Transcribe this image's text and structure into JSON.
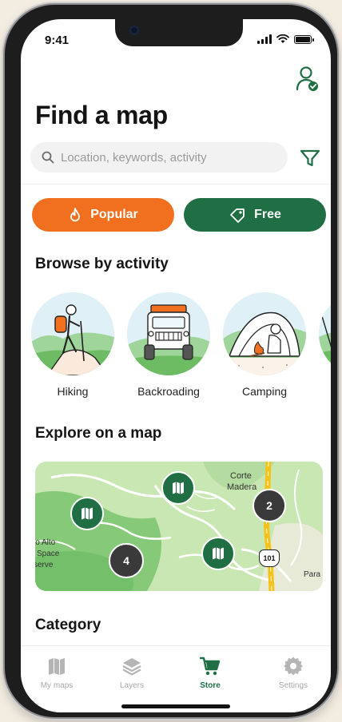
{
  "status": {
    "time": "9:41"
  },
  "header": {
    "title": "Find a map",
    "account_icon": "account-check-icon"
  },
  "search": {
    "placeholder": "Location, keywords, activity",
    "value": "",
    "filter_icon": "filter-funnel-icon"
  },
  "pills": [
    {
      "label": "Popular",
      "icon": "flame-icon",
      "color": "#f07020"
    },
    {
      "label": "Free",
      "icon": "tag-icon",
      "color": "#1f6e44"
    }
  ],
  "sections": {
    "activities_title": "Browse by activity",
    "map_title": "Explore on a map",
    "category_title": "Category"
  },
  "activities": [
    {
      "label": "Hiking",
      "icon": "hiking-illustration"
    },
    {
      "label": "Backroading",
      "icon": "backroading-illustration"
    },
    {
      "label": "Camping",
      "icon": "camping-illustration"
    },
    {
      "label": "",
      "icon": "more-activity-illustration"
    }
  ],
  "map": {
    "place_labels": [
      "Corte",
      "Madera",
      "lo Alto",
      "Space",
      "serve",
      "Para"
    ],
    "clusters": [
      "2",
      "4"
    ],
    "route_shield": "101",
    "marker_icon": "map-marker-icon"
  },
  "tabs": [
    {
      "label": "My maps",
      "icon": "my-maps-icon",
      "active": false
    },
    {
      "label": "Layers",
      "icon": "layers-icon",
      "active": false
    },
    {
      "label": "Store",
      "icon": "cart-icon",
      "active": true
    },
    {
      "label": "Settings",
      "icon": "settings-gear-icon",
      "active": false
    }
  ],
  "colors": {
    "brand_green": "#1f6e44",
    "accent_orange": "#f07020",
    "map_green_light": "#c9e7b3",
    "map_green_dark": "#74c06a",
    "cluster_dark": "#3a3a3a"
  }
}
